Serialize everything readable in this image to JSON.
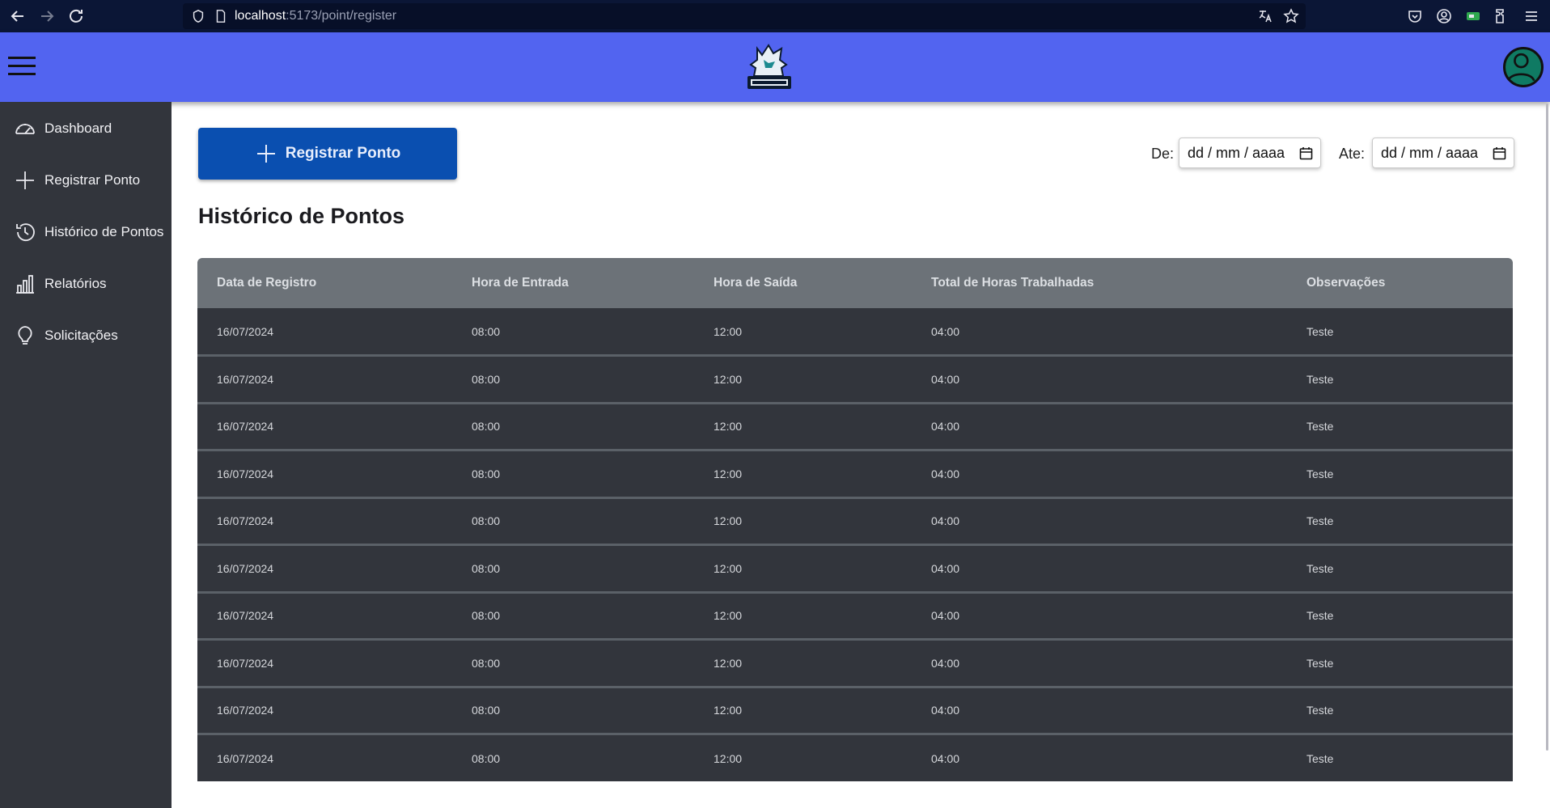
{
  "browser": {
    "url_host": "localhost",
    "url_path": ":5173/point/register"
  },
  "colors": {
    "header_bg": "#5264f0",
    "sidebar_bg": "#32353c",
    "button_bg": "#0a4fb0",
    "table_header_bg": "#6c7278",
    "table_row_bg": "#32353c"
  },
  "sidebar": {
    "items": [
      {
        "label": "Dashboard",
        "icon": "speedometer-icon"
      },
      {
        "label": "Registrar Ponto",
        "icon": "plus-icon"
      },
      {
        "label": "Histórico de Pontos",
        "icon": "history-icon"
      },
      {
        "label": "Relatórios",
        "icon": "bar-chart-icon"
      },
      {
        "label": "Solicitações",
        "icon": "lightbulb-icon"
      }
    ]
  },
  "main": {
    "register_button": "Registrar Ponto",
    "from_label": "De:",
    "to_label": "Ate:",
    "from_placeholder": "dd / mm / aaaa",
    "to_placeholder": "dd / mm / aaaa",
    "title": "Histórico de Pontos"
  },
  "table": {
    "headers": [
      "Data de Registro",
      "Hora de Entrada",
      "Hora de Saída",
      "Total de Horas Trabalhadas",
      "Observações"
    ],
    "rows": [
      [
        "16/07/2024",
        "08:00",
        "12:00",
        "04:00",
        "Teste"
      ],
      [
        "16/07/2024",
        "08:00",
        "12:00",
        "04:00",
        "Teste"
      ],
      [
        "16/07/2024",
        "08:00",
        "12:00",
        "04:00",
        "Teste"
      ],
      [
        "16/07/2024",
        "08:00",
        "12:00",
        "04:00",
        "Teste"
      ],
      [
        "16/07/2024",
        "08:00",
        "12:00",
        "04:00",
        "Teste"
      ],
      [
        "16/07/2024",
        "08:00",
        "12:00",
        "04:00",
        "Teste"
      ],
      [
        "16/07/2024",
        "08:00",
        "12:00",
        "04:00",
        "Teste"
      ],
      [
        "16/07/2024",
        "08:00",
        "12:00",
        "04:00",
        "Teste"
      ],
      [
        "16/07/2024",
        "08:00",
        "12:00",
        "04:00",
        "Teste"
      ],
      [
        "16/07/2024",
        "08:00",
        "12:00",
        "04:00",
        "Teste"
      ]
    ]
  }
}
